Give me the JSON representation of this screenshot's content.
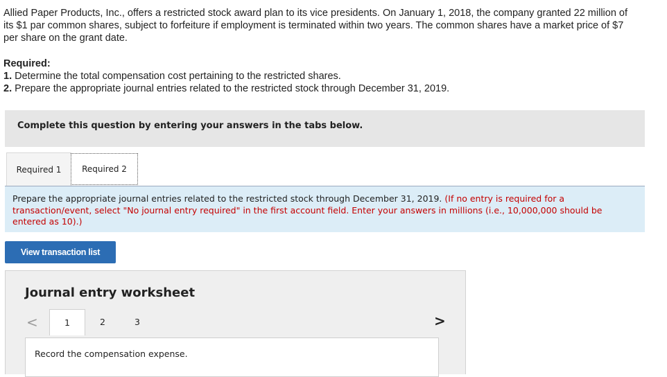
{
  "problem": {
    "text": "Allied Paper Products, Inc., offers a restricted stock award plan to its vice presidents. On January 1, 2018, the company granted 22 million of its $1 par common shares, subject to forfeiture if employment is terminated within two years. The common shares have a market price of $7 per share on the grant date."
  },
  "required": {
    "heading": "Required:",
    "item1_num": "1.",
    "item1_text": " Determine the total compensation cost pertaining to the restricted shares.",
    "item2_num": "2.",
    "item2_text": " Prepare the appropriate journal entries related to the restricted stock through December 31, 2019."
  },
  "complete_bar": {
    "text": "Complete this question by entering your answers in the tabs below."
  },
  "tabs": [
    {
      "label": "Required 1"
    },
    {
      "label": "Required 2"
    }
  ],
  "instruction": {
    "main": "Prepare the appropriate journal entries related to the restricted stock through December 31, 2019. ",
    "note": "(If no entry is required for a transaction/event, select \"No journal entry required\" in the first account field. Enter your answers in millions (i.e., 10,000,000 should be entered as 10).)"
  },
  "view_button": {
    "label": "View transaction list"
  },
  "worksheet": {
    "title": "Journal entry worksheet",
    "prev": "<",
    "next": ">",
    "pages": [
      "1",
      "2",
      "3"
    ],
    "record_text": "Record the compensation expense."
  }
}
